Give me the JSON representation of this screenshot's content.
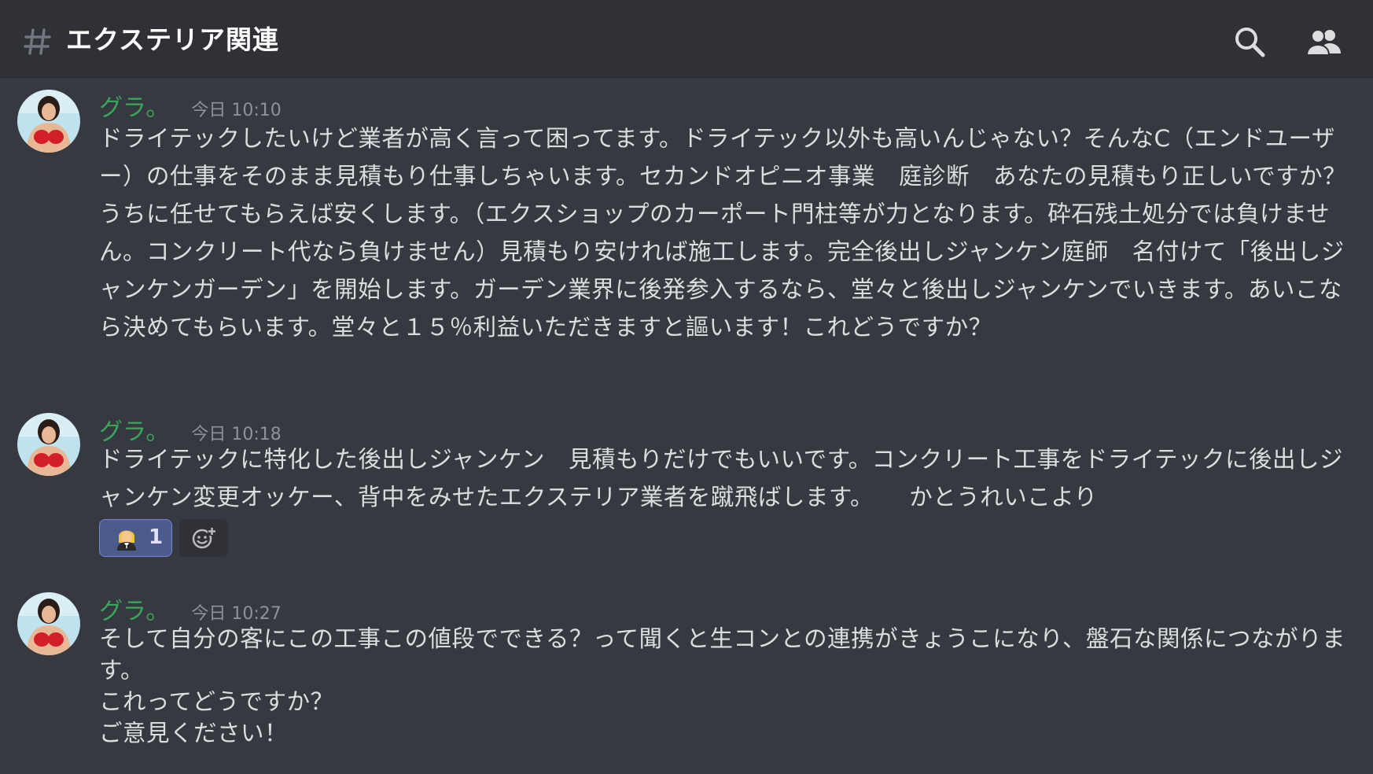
{
  "header": {
    "channel_name": "エクステリア関連"
  },
  "messages": [
    {
      "author": "グラ。",
      "timestamp": "今日 10:10",
      "text": "ドライテックしたいけど業者が高く言って困ってます。ドライテック以外も高いんじゃない？そんなC（エンドユーザー）の仕事をそのまま見積もり仕事しちゃいます。セカンドオピニオ事業　庭診断　あなたの見積もり正しいですか？うちに任せてもらえば安くします。（エクスショップのカーポート門柱等が力となります。砕石残土処分では負けません。コンクリート代なら負けません）見積もり安ければ施工します。完全後出しジャンケン庭師　名付けて「後出しジャンケンガーデン」を開始します。ガーデン業界に後発参入するなら、堂々と後出しジャンケンでいきます。あいこなら決めてもらいます。堂々と１５％利益いただきますと謳います！これどうですか？"
    },
    {
      "author": "グラ。",
      "timestamp": "今日 10:18",
      "text": "ドライテックに特化した後出しジャンケン　見積もりだけでもいいです。コンクリート工事をドライテックに後出しジャンケン変更オッケー、背中をみせたエクステリア業者を蹴飛ばします。　　かとうれいこより",
      "reactions": [
        {
          "emoji": "woman-in-tuxedo",
          "count": "1"
        }
      ]
    },
    {
      "author": "グラ。",
      "timestamp": "今日 10:27",
      "text": "そして自分の客にこの工事この値段でできる？って聞くと生コンとの連携がきょうこになり、盤石な関係につながります。\nこれってどうですか？\nご意見ください！"
    }
  ],
  "icons": {
    "channel": "hash-icon",
    "search": "search-icon",
    "members": "members-icon",
    "add_reaction": "add-reaction-icon"
  },
  "colors": {
    "background": "#36393f",
    "header": "#2f3136",
    "username": "#3ba55c",
    "timestamp": "#8e9297",
    "text": "#dcddde",
    "reaction_bg": "#4b5b8e",
    "reaction_border": "#7289da"
  }
}
